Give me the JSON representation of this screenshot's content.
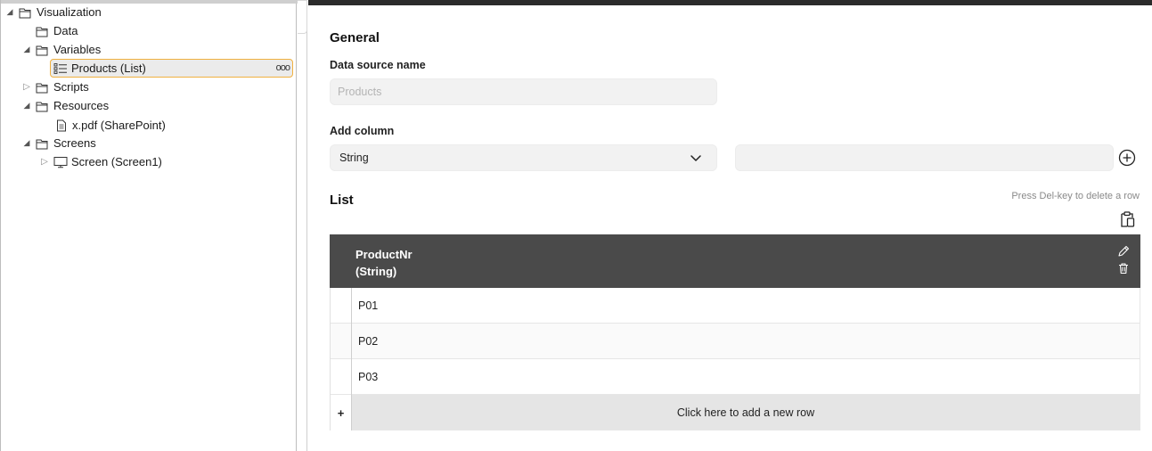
{
  "tree": {
    "items": [
      {
        "label": "Visualization",
        "icon": "folder-icon",
        "expanded": true
      },
      {
        "label": "Data",
        "icon": "folder-icon"
      },
      {
        "label": "Variables",
        "icon": "folder-icon",
        "expanded": true
      },
      {
        "label": "Products (List)",
        "icon": "list-icon",
        "selected": true,
        "more": "ooo"
      },
      {
        "label": "Scripts",
        "icon": "folder-icon",
        "expanded": false
      },
      {
        "label": "Resources",
        "icon": "folder-icon",
        "expanded": true
      },
      {
        "label": "x.pdf (SharePoint)",
        "icon": "document-icon"
      },
      {
        "label": "Screens",
        "icon": "folder-icon",
        "expanded": true
      },
      {
        "label": "Screen (Screen1)",
        "icon": "monitor-icon",
        "expanded": false
      }
    ]
  },
  "general": {
    "heading": "General",
    "datasource_label": "Data source name",
    "datasource_placeholder": "Products"
  },
  "add_column": {
    "label": "Add column",
    "type_value": "String",
    "name_value": ""
  },
  "list": {
    "heading": "List",
    "hint": "Press Del-key to delete a row",
    "columns": [
      {
        "name": "ProductNr",
        "type": "(String)"
      }
    ],
    "rows": [
      "P01",
      "P02",
      "P03"
    ],
    "add_gutter": "+",
    "add_row_label": "Click here to add a new row"
  },
  "colors": {
    "selection_border": "#f0b140",
    "header_bg": "#4a4a4a",
    "editor_top": "#2b2b2b"
  }
}
